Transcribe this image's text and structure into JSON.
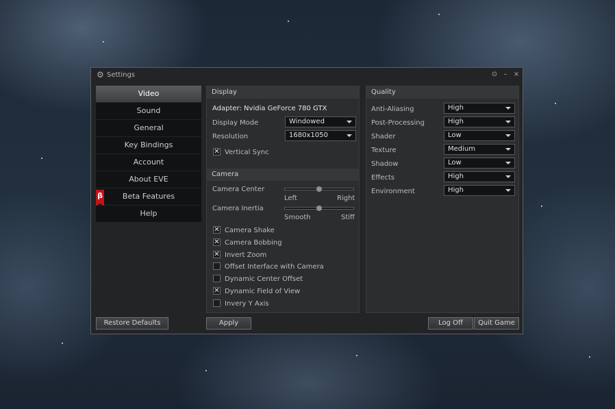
{
  "window": {
    "title": "Settings"
  },
  "nav": [
    {
      "label": "Video"
    },
    {
      "label": "Sound"
    },
    {
      "label": "General"
    },
    {
      "label": "Key Bindings"
    },
    {
      "label": "Account"
    },
    {
      "label": "About EVE"
    },
    {
      "label": "Beta Features",
      "badge": "β"
    },
    {
      "label": "Help"
    }
  ],
  "display": {
    "header": "Display",
    "adapter": "Adapter: Nvidia GeForce 780 GTX",
    "display_mode_label": "Display Mode",
    "display_mode_value": "Windowed",
    "resolution_label": "Resolution",
    "resolution_value": "1680x1050",
    "vsync_label": "Vertical Sync"
  },
  "camera": {
    "header": "Camera",
    "center_label": "Camera Center",
    "center_left": "Left",
    "center_right": "Right",
    "center_value": 0.5,
    "inertia_label": "Camera Inertia",
    "inertia_left": "Smooth",
    "inertia_right": "Stiff",
    "inertia_value": 0.5,
    "options": [
      {
        "label": "Camera Shake",
        "checked": true
      },
      {
        "label": "Camera Bobbing",
        "checked": true
      },
      {
        "label": "Invert Zoom",
        "checked": true
      },
      {
        "label": "Offset Interface with Camera",
        "checked": false
      },
      {
        "label": "Dynamic Center Offset",
        "checked": false
      },
      {
        "label": "Dynamic Field of View",
        "checked": true
      },
      {
        "label": "Invery Y Axis",
        "checked": false
      }
    ]
  },
  "quality": {
    "header": "Quality",
    "rows": [
      {
        "label": "Anti-Aliasing",
        "value": "High"
      },
      {
        "label": "Post-Processing",
        "value": "High"
      },
      {
        "label": "Shader",
        "value": "Low"
      },
      {
        "label": "Texture",
        "value": "Medium"
      },
      {
        "label": "Shadow",
        "value": "Low"
      },
      {
        "label": "Effects",
        "value": "High"
      },
      {
        "label": "Environment",
        "value": "High"
      }
    ]
  },
  "buttons": {
    "restore": "Restore Defaults",
    "apply": "Apply",
    "logoff": "Log Off",
    "quit": "Quit Game"
  }
}
